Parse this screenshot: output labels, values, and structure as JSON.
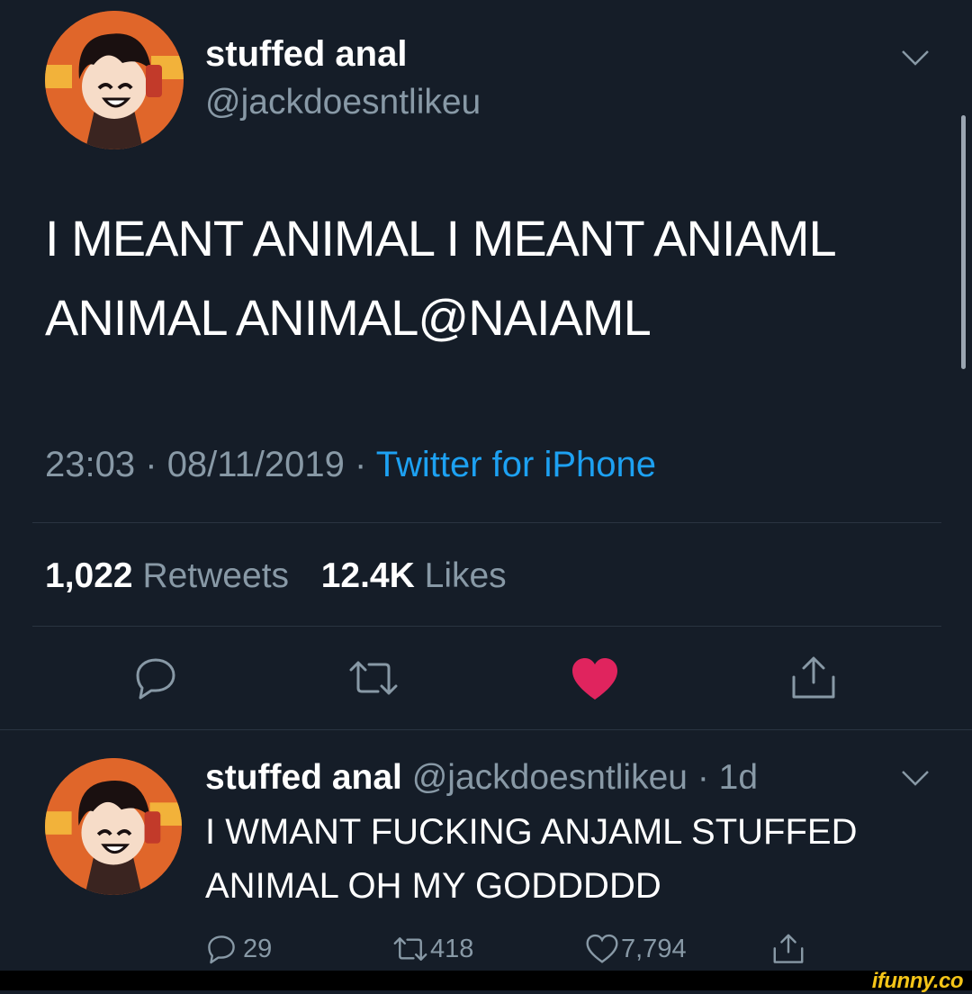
{
  "tweet": {
    "display_name": "stuffed anal",
    "handle": "@jackdoesntlikeu",
    "text_line1": "I MEANT ANIMAL I MEANT ANIAML",
    "text_line2": "ANIMAL ANIMAL@NAIAML",
    "time": "23:03",
    "separator": "·",
    "date": "08/11/2019",
    "source": "Twitter for iPhone",
    "retweet_count": "1,022",
    "retweet_label": "Retweets",
    "like_count": "12.4K",
    "like_label": "Likes",
    "liked": true
  },
  "reply": {
    "display_name": "stuffed anal",
    "handle": "@jackdoesntlikeu",
    "age": "· 1d",
    "text_line1": "I WMANT FUCKING ANJAML STUFFED",
    "text_line2": "ANIMAL OH MY GODDDDD",
    "reply_count": "29",
    "retweet_count": "418",
    "like_count": "7,794"
  },
  "watermark": "ifunny.co",
  "colors": {
    "background": "#151d28",
    "muted": "#8899a6",
    "accent": "#1da1f2",
    "like": "#e0245e"
  },
  "icons": [
    "chevron-down-icon",
    "reply-icon",
    "retweet-icon",
    "heart-icon",
    "share-icon"
  ]
}
